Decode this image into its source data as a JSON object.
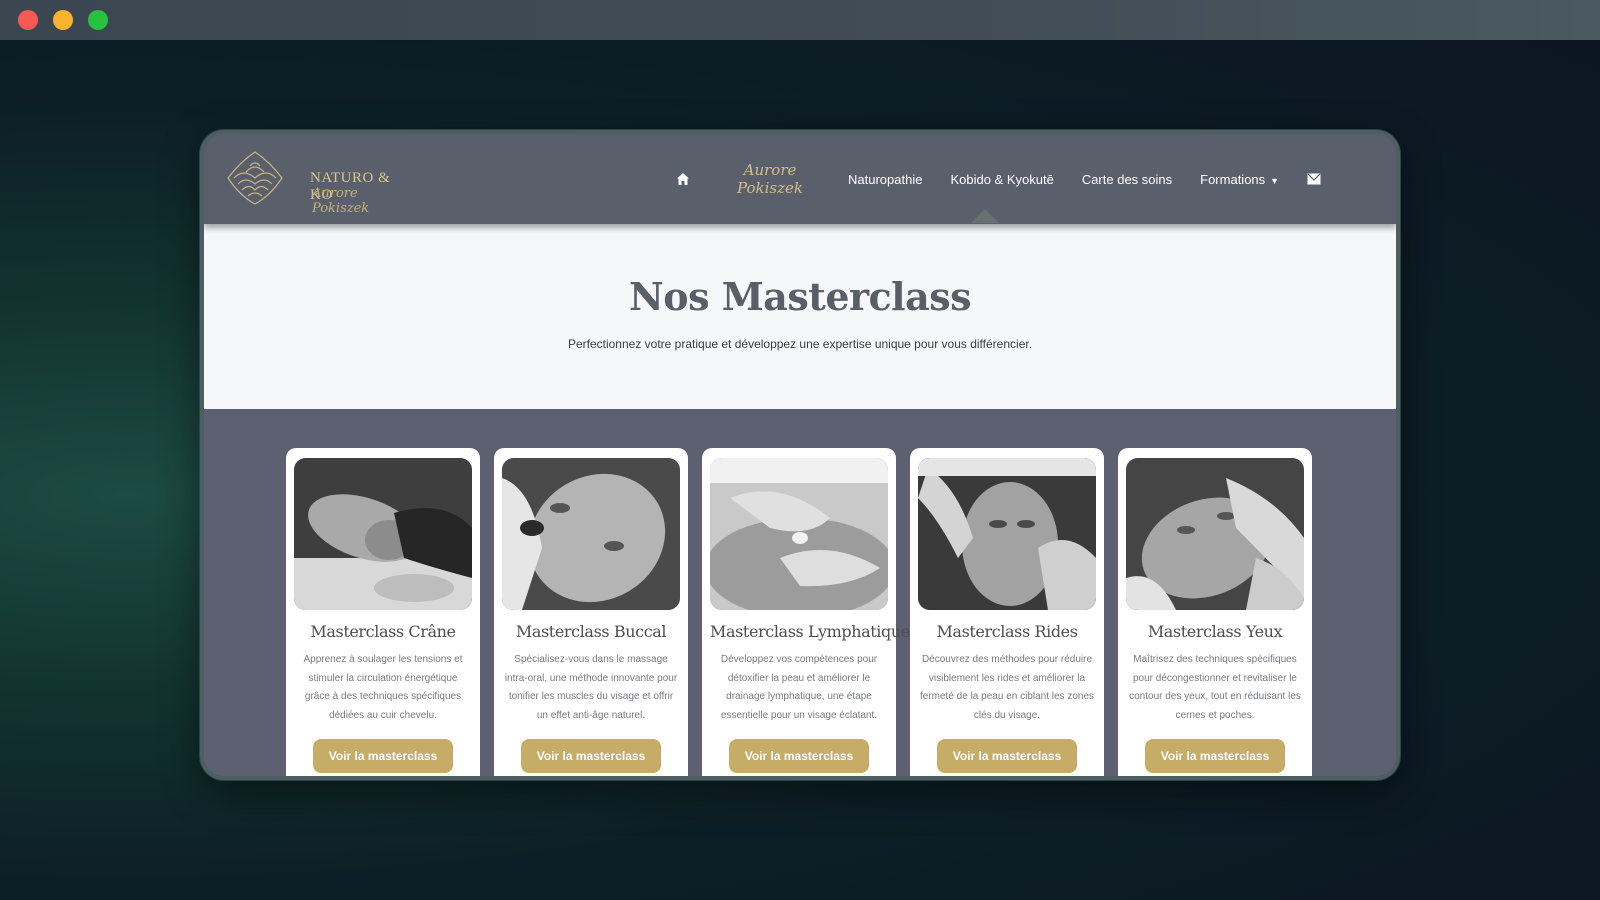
{
  "window": {
    "controls": [
      "close",
      "minimize",
      "maximize"
    ]
  },
  "brand": {
    "name": "NATURO & KO",
    "signature": "Aurore Pokiszek",
    "accent_color": "#c7ac67",
    "nav_bg": "#5a5f6c"
  },
  "nav": {
    "home_icon": "home-icon",
    "signature_link": "Aurore Pokiszek",
    "items": [
      {
        "label": "Naturopathie"
      },
      {
        "label": "Kobido & Kyokutē"
      },
      {
        "label": "Carte des soins"
      },
      {
        "label": "Formations",
        "has_dropdown": true
      }
    ],
    "mail_icon": "mail-icon"
  },
  "hero": {
    "title": "Nos Masterclass",
    "subtitle": "Perfectionnez votre pratique et développez une expertise unique pour vous différencier."
  },
  "cards": [
    {
      "title": "Masterclass Crâne",
      "description": "Apprenez à soulager les tensions et stimuler la circulation énergétique grâce à des techniques spécifiques dédiées au cuir chevelu.",
      "button": "Voir la masterclass"
    },
    {
      "title": "Masterclass Buccal",
      "description": "Spécialisez-vous dans le massage intra-oral, une méthode innovante pour tonifier les muscles du visage et offrir un effet anti-âge naturel.",
      "button": "Voir la masterclass"
    },
    {
      "title": "Masterclass Lymphatique",
      "description": "Développez vos compétences pour détoxifier la peau et améliorer le drainage lymphatique, une étape essentielle pour un visage éclatant.",
      "button": "Voir la masterclass"
    },
    {
      "title": "Masterclass Rides",
      "description": "Découvrez des méthodes pour réduire visiblement les rides et améliorer la fermeté de la peau en ciblant les zones clés du visage.",
      "button": "Voir la masterclass"
    },
    {
      "title": "Masterclass Yeux",
      "description": "Maîtrisez des techniques spécifiques pour décongestionner et revitaliser le contour des yeux, tout en réduisant les cernes et poches.",
      "button": "Voir la masterclass"
    }
  ]
}
